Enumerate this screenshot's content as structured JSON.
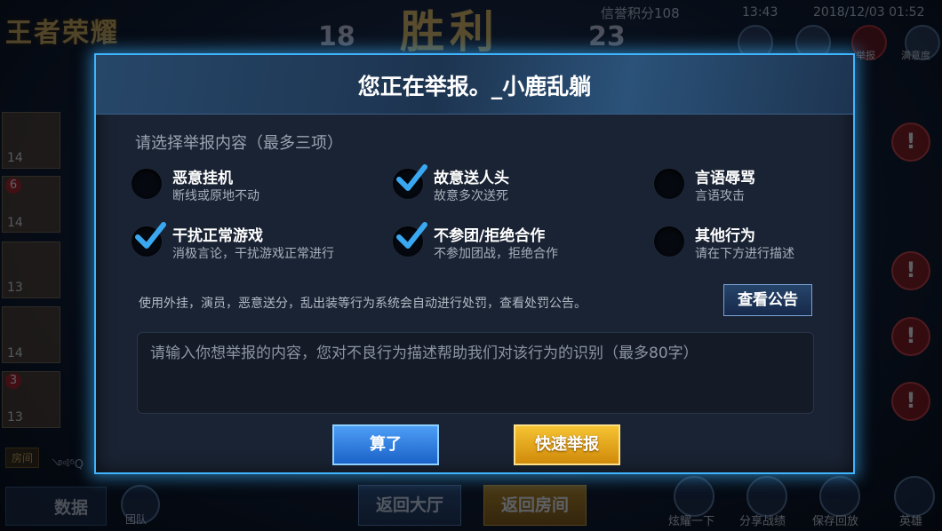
{
  "background": {
    "logo": "王者荣耀",
    "score_left": "18",
    "victory": "胜利",
    "score_right": "23",
    "credit": "信誉积分108",
    "time": "13:43",
    "date": "2018/12/03 01:52",
    "top_labels": [
      "举报",
      "满意度"
    ],
    "hero_levels": [
      "14",
      "14",
      "13",
      "14",
      "13"
    ],
    "hero_badges": [
      "6",
      "3"
    ],
    "room_tag": "房间",
    "room_chars": "༺ᵟQ",
    "bottom_data": "数据",
    "bottom_team": "团队",
    "back_to_hall": "返回大厅",
    "back_to_room": "返回房间",
    "bottom_right": [
      "炫耀一下",
      "分享战绩",
      "保存回放",
      "英雄"
    ]
  },
  "dialog": {
    "title": "您正在举报。_小鹿乱躺",
    "section_title": "请选择举报内容（最多三项）",
    "options": [
      {
        "label": "恶意挂机",
        "desc": "断线或原地不动",
        "checked": false
      },
      {
        "label": "故意送人头",
        "desc": "故意多次送死",
        "checked": true
      },
      {
        "label": "言语辱骂",
        "desc": "言语攻击",
        "checked": false
      },
      {
        "label": "干扰正常游戏",
        "desc": "消极言论，干扰游戏正常进行",
        "checked": true
      },
      {
        "label": "不参团/拒绝合作",
        "desc": "不参加团战，拒绝合作",
        "checked": true
      },
      {
        "label": "其他行为",
        "desc": "请在下方进行描述",
        "checked": false
      }
    ],
    "notice": "使用外挂，演员，恶意送分，乱出装等行为系统会自动进行处罚，查看处罚公告。",
    "notice_button": "查看公告",
    "textarea_placeholder": "请输入你想举报的内容，您对不良行为描述帮助我们对该行为的识别（最多80字）",
    "cancel_button": "算了",
    "report_button": "快速举报"
  },
  "colors": {
    "dialog_border": "#3fb5ff",
    "check": "#3aa8f0",
    "cancel": "#1a62c8",
    "report": "#f0a818"
  }
}
